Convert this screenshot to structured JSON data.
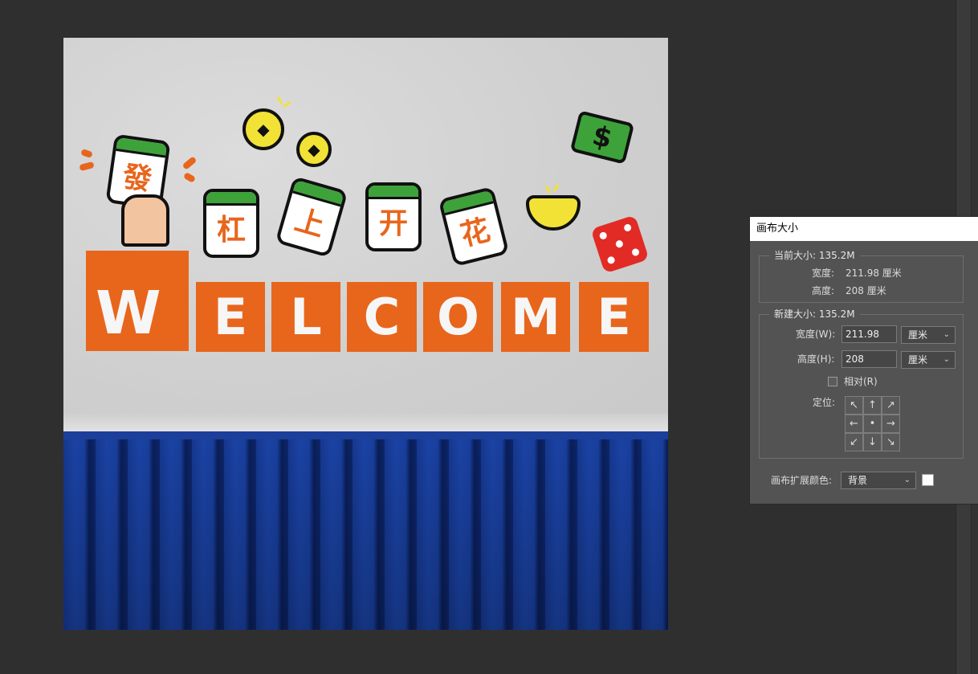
{
  "dialog": {
    "title": "画布大小",
    "current_size": {
      "title": "当前大小: 135.2M",
      "width_label": "宽度:",
      "width_value": "211.98 厘米",
      "height_label": "高度:",
      "height_value": "208 厘米"
    },
    "new_size": {
      "title": "新建大小: 135.2M",
      "width_label": "宽度(W):",
      "width_value": "211.98",
      "width_unit": "厘米",
      "height_label": "高度(H):",
      "height_value": "208",
      "height_unit": "厘米",
      "relative_label": "相对(R)",
      "relative_checked": false,
      "anchor_label": "定位:",
      "anchor_cells": [
        "↖",
        "↑",
        "↗",
        "←",
        "•",
        "→",
        "↙",
        "↓",
        "↘"
      ]
    },
    "extension_color_label": "画布扩展颜色:",
    "extension_color_value": "背景",
    "extension_swatch_color": "#ffffff"
  },
  "artwork": {
    "mahjong_tiles": [
      "發",
      "杠",
      "上",
      "开",
      "花"
    ],
    "welcome_letters": [
      "W",
      "E",
      "L",
      "C",
      "O",
      "M",
      "E"
    ],
    "coin_glyph": "◆",
    "dollar_sign": "$",
    "accent_orange": "#e8651c",
    "mahjong_green": "#3ea23a",
    "wall_blue": "#1b3f9a"
  }
}
